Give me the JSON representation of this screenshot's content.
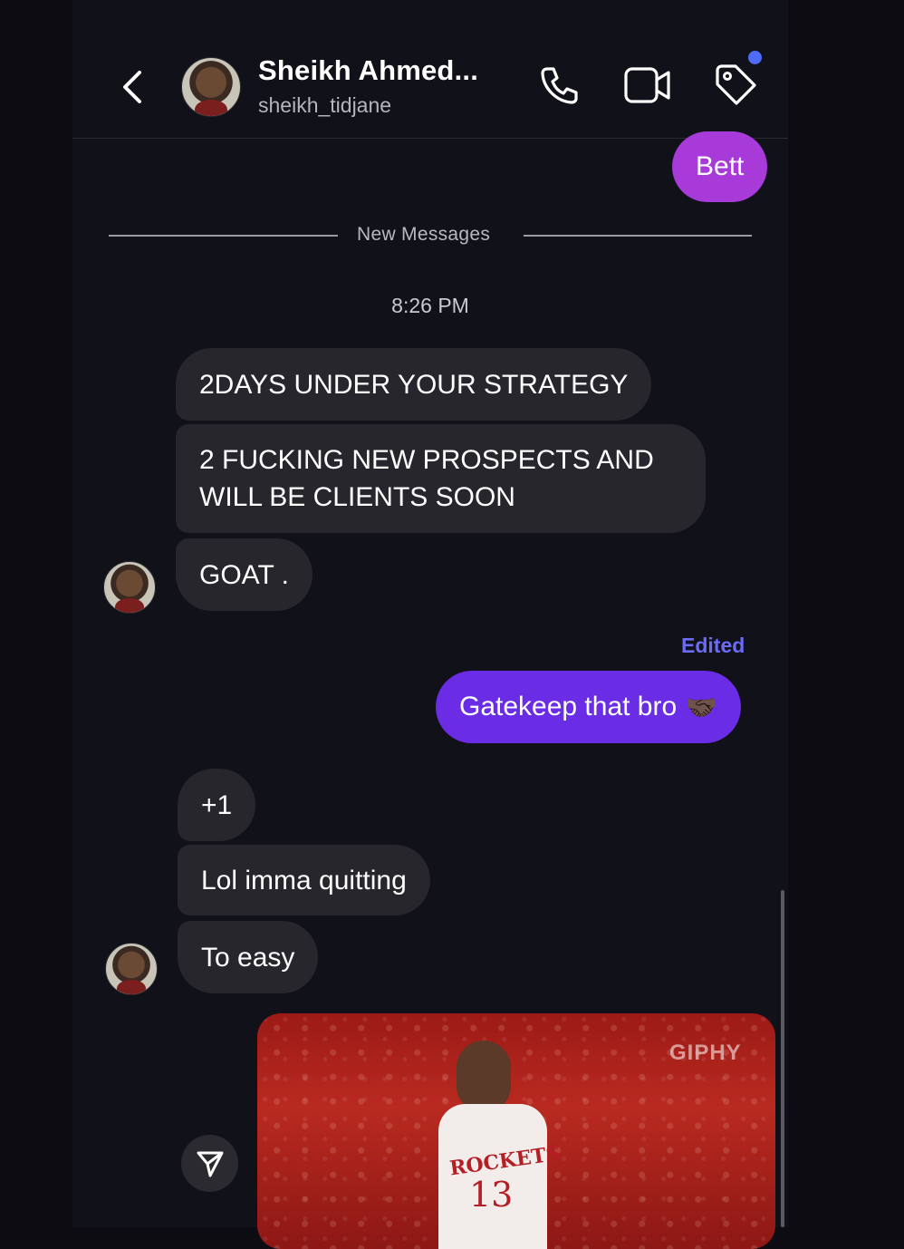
{
  "header": {
    "name": "Sheikh Ahmed...",
    "username": "sheikh_tidjane"
  },
  "icons": {
    "back": "chevron-left-icon",
    "call": "phone-icon",
    "video": "video-camera-icon",
    "tag": "tag-icon",
    "send": "paper-plane-icon"
  },
  "colors": {
    "accent_purple": "#a73ad9",
    "accent_violet": "#6b2ce6",
    "edited_label": "#6a6cf5",
    "incoming_bubble": "#26262c",
    "notification_dot": "#4f6cf7"
  },
  "messages": {
    "outgoing_1": "Bett",
    "divider": "New Messages",
    "timestamp": "8:26 PM",
    "incoming_1": "2DAYS UNDER YOUR STRATEGY",
    "incoming_2": "2 FUCKING NEW PROSPECTS AND WILL BE CLIENTS SOON",
    "incoming_3": "GOAT .",
    "edited_label": "Edited",
    "outgoing_2": "Gatekeep that bro",
    "outgoing_2_emoji": "🤝🏿",
    "incoming_4": "+1",
    "incoming_5": "Lol imma quitting",
    "incoming_6": "To easy"
  },
  "gif": {
    "watermark": "GIPHY",
    "jersey_team": "ROCKETS",
    "jersey_number": "13"
  }
}
